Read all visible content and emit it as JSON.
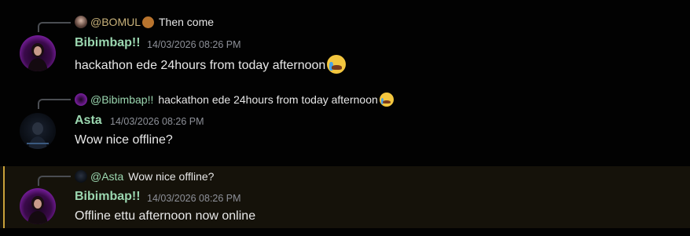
{
  "messages": [
    {
      "reply": {
        "username": "@BOMUL",
        "icon": "sheep-emoji",
        "text": "Then come"
      },
      "author": "Bibimbap!!",
      "timestamp": "14/03/2026 08:26 PM",
      "content": "hackathon ede 24hours from  today afternoon",
      "content_emoji": "loudly-crying-face-icon"
    },
    {
      "reply": {
        "username": "@Bibimbap!!",
        "text": "hackathon ede 24hours from  today afternoon",
        "icon": "loudly-crying-face-icon"
      },
      "author": "Asta",
      "timestamp": "14/03/2026 08:26 PM",
      "content": "Wow nice offline?"
    },
    {
      "reply": {
        "username": "@Asta",
        "text": "Wow nice offline?"
      },
      "author": "Bibimbap!!",
      "timestamp": "14/03/2026 08:26 PM",
      "content": "Offline ettu afternoon now online",
      "highlighted": true
    }
  ],
  "colors": {
    "background": "#020202",
    "highlight_bg": "#15120a",
    "highlight_bar": "#c9a13a",
    "username": "#9bd7b0",
    "timestamp": "#8d9098",
    "text": "#e8e8e8"
  }
}
